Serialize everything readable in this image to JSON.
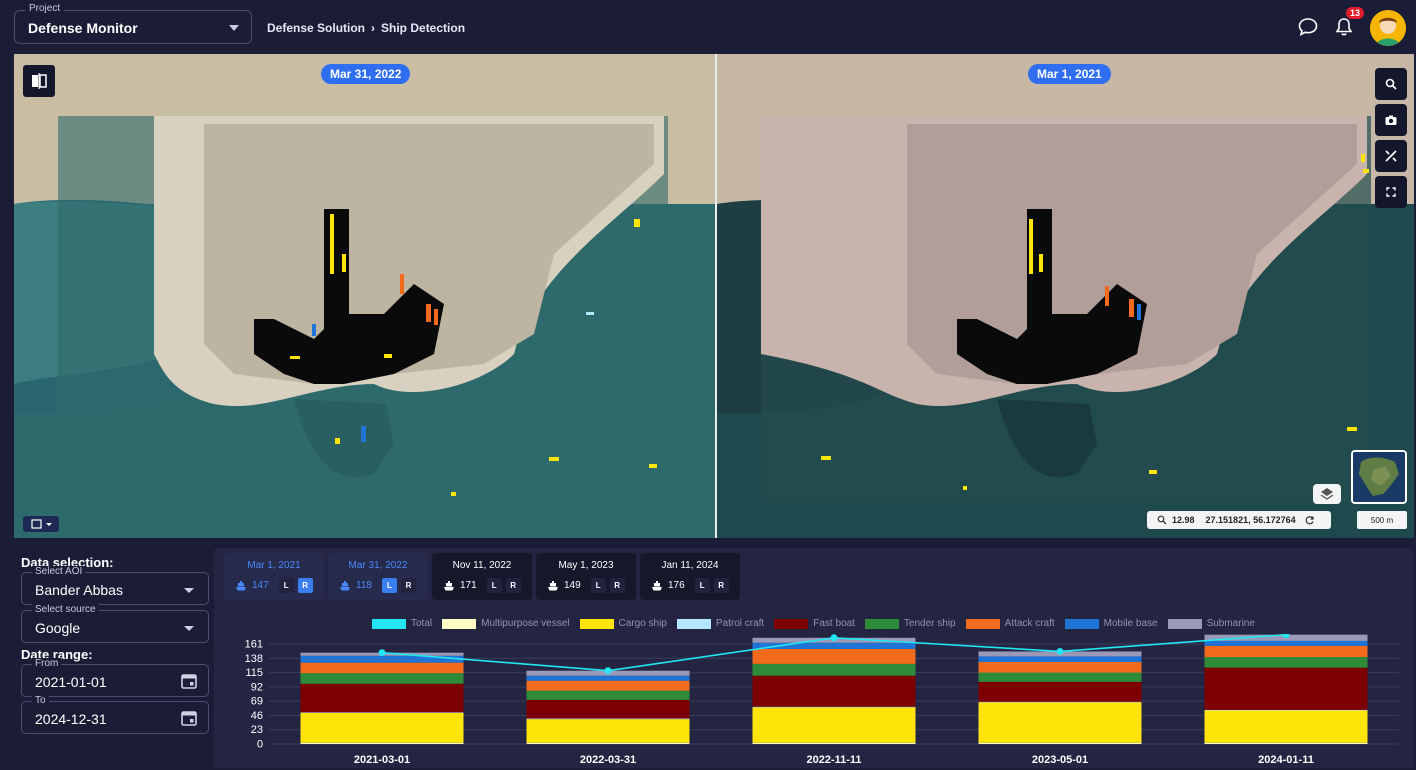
{
  "header": {
    "project_label": "Project",
    "project_value": "Defense Monitor",
    "breadcrumb": [
      "Defense Solution",
      "Ship Detection"
    ],
    "notification_count": "13"
  },
  "map": {
    "left_date": "Mar 31, 2022",
    "right_date": "Mar 1, 2021",
    "zoom": "12.98",
    "coords": "27.151821,  56.172764",
    "scale": "500 m",
    "tools": [
      "search-icon",
      "camera-icon",
      "measure-icon",
      "fullscreen-icon"
    ]
  },
  "sidebar": {
    "title": "Data selection:",
    "aoi_label": "Select AOI",
    "aoi_value": "Bander Abbas",
    "source_label": "Select source",
    "source_value": "Google",
    "date_range_title": "Date range:",
    "from_label": "From",
    "from_value": "2021-01-01",
    "to_label": "To",
    "to_value": "2024-12-31"
  },
  "date_tabs": [
    {
      "date": "Mar 1, 2021",
      "count": "147",
      "active": true,
      "l_on": false,
      "r_on": true
    },
    {
      "date": "Mar 31, 2022",
      "count": "118",
      "active": true,
      "l_on": true,
      "r_on": false
    },
    {
      "date": "Nov 11, 2022",
      "count": "171",
      "active": false,
      "l_on": false,
      "r_on": false
    },
    {
      "date": "May 1, 2023",
      "count": "149",
      "active": false,
      "l_on": false,
      "r_on": false
    },
    {
      "date": "Jan 11, 2024",
      "count": "176",
      "active": false,
      "l_on": false,
      "r_on": false
    }
  ],
  "lr_labels": {
    "l": "L",
    "r": "R"
  },
  "colors": {
    "Total": "#22e6f2",
    "Multipurpose vessel": "#fffcc4",
    "Cargo ship": "#ffe40a",
    "Patrol craft": "#b3e7ff",
    "Fast boat": "#7d0000",
    "Tender ship": "#2e8b3a",
    "Attack craft": "#f26b1d",
    "Mobile base": "#1f74d6",
    "Submarine": "#9a9ab8"
  },
  "chart_data": {
    "type": "bar",
    "stacked": true,
    "categories": [
      "2021-03-01",
      "2022-03-31",
      "2022-11-11",
      "2023-05-01",
      "2024-01-11"
    ],
    "yticks": [
      0,
      23,
      46,
      69,
      92,
      115,
      138,
      161
    ],
    "ylim": [
      0,
      161
    ],
    "series": [
      {
        "name": "Multipurpose vessel",
        "values": [
          2,
          2,
          2,
          2,
          2
        ]
      },
      {
        "name": "Cargo ship",
        "values": [
          48,
          38,
          57,
          65,
          52
        ]
      },
      {
        "name": "Patrol craft",
        "values": [
          1,
          1,
          1,
          1,
          1
        ]
      },
      {
        "name": "Fast boat",
        "values": [
          46,
          30,
          50,
          32,
          68
        ]
      },
      {
        "name": "Tender ship",
        "values": [
          17,
          15,
          19,
          15,
          17
        ]
      },
      {
        "name": "Attack craft",
        "values": [
          17,
          16,
          24,
          17,
          18
        ]
      },
      {
        "name": "Mobile base",
        "values": [
          11,
          8,
          10,
          9,
          8
        ]
      },
      {
        "name": "Submarine",
        "values": [
          5,
          8,
          8,
          8,
          10
        ]
      }
    ],
    "line": {
      "name": "Total",
      "values": [
        147,
        118,
        171,
        149,
        176
      ]
    },
    "grid": true,
    "legend_position": "top"
  }
}
